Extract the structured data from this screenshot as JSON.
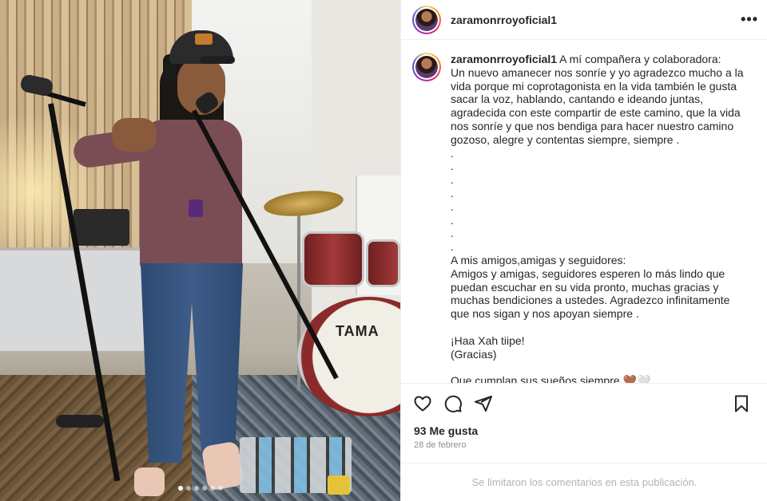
{
  "post": {
    "username": "zaramonrroyoficial1",
    "caption_text": " A mí compañera y colaboradora:\nUn nuevo amanecer nos sonríe y yo agradezco mucho a la vida porque mi coprotagonista en la vida también le gusta sacar la voz, hablando, cantando e ideando juntas, agradecida con este compartir de este camino, que la vida nos sonríe y que nos bendiga para hacer nuestro camino gozoso, alegre y contentas siempre, siempre .\n.\n.\n.\n.\n.\n.\n.\n.\nA mis amigos,amigas y seguidores:\nAmigos y amigas, seguidores esperen lo más lindo que puedan escuchar en su vida pronto, muchas gracias y muchas bendiciones a ustedes. Agradezco infinitamente que nos sigan y nos apoyan siempre .\n\n¡Haa Xah tiipe!\n(Gracias)\n\nQue cumplan sus sueños siempre 🤎🤍",
    "likes": "93 Me gusta",
    "date": "28 de febrero",
    "comments_disabled": "Se limitaron los comentarios en esta publicación.",
    "more_menu": "•••"
  },
  "photo": {
    "kick_drum_logo": "TAMA",
    "carousel": {
      "count": 6,
      "active": 0
    }
  },
  "icons": {
    "like": "heart-icon",
    "comment": "comment-icon",
    "share": "share-icon",
    "save": "bookmark-icon",
    "more": "more-options-icon"
  },
  "colors": {
    "text": "#262626",
    "muted": "#8e8e8e",
    "divider": "#efefef"
  }
}
